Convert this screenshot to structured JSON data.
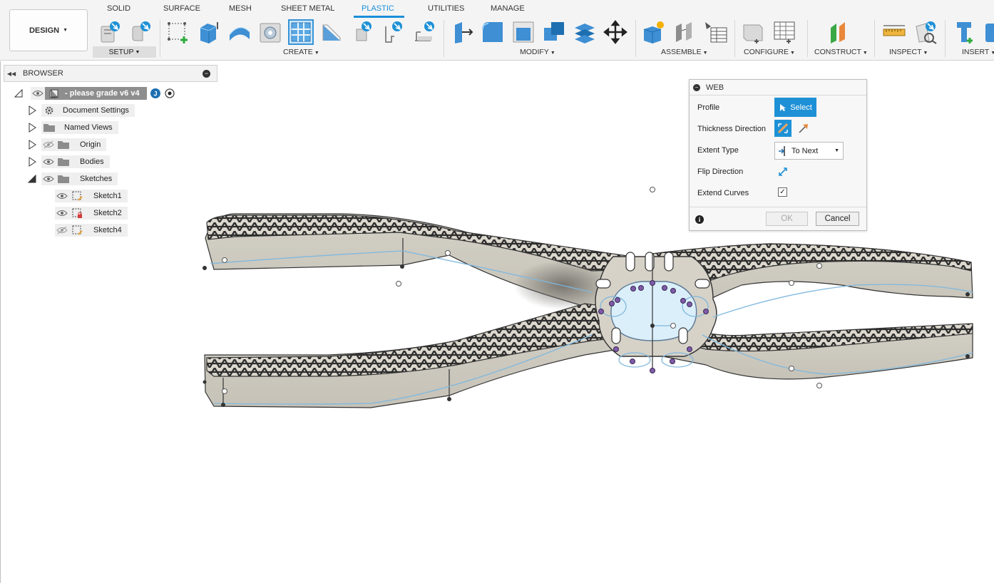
{
  "workspace": {
    "label": "DESIGN"
  },
  "tabs": [
    {
      "label": "SOLID",
      "active": false
    },
    {
      "label": "SURFACE",
      "active": false
    },
    {
      "label": "MESH",
      "active": false
    },
    {
      "label": "SHEET METAL",
      "active": false
    },
    {
      "label": "PLASTIC",
      "active": true
    },
    {
      "label": "UTILITIES",
      "active": false
    },
    {
      "label": "MANAGE",
      "active": false
    }
  ],
  "groups": {
    "setup": "SETUP",
    "create": "CREATE",
    "modify": "MODIFY",
    "assemble": "ASSEMBLE",
    "configure": "CONFIGURE",
    "construct": "CONSTRUCT",
    "inspect": "INSPECT",
    "insert": "INSERT"
  },
  "toolbar_icons": [
    "plastic-rule-icon",
    "material-icon",
    "create-sketch-icon",
    "extrude-box-icon",
    "shell-icon",
    "boss-icon",
    "web-icon",
    "rib-icon",
    "rest-icon",
    "lip-groove-icon",
    "snap-fit-icon",
    "press-pull-icon",
    "fillet-icon",
    "chamfer-icon",
    "combine-icon",
    "offset-face-icon",
    "move-icon",
    "new-component-icon",
    "joint-icon",
    "table-icon",
    "change-parameters-icon",
    "configure-table-icon",
    "offset-plane-icon",
    "measure-icon",
    "interference-icon",
    "insert-bolt-icon"
  ],
  "browser": {
    "title": "BROWSER",
    "root": "- please grade v6 v4",
    "items": [
      {
        "label": "Document Settings",
        "icon": "gear-icon"
      },
      {
        "label": "Named Views",
        "icon": "folder-icon"
      },
      {
        "label": "Origin",
        "icon": "folder-icon",
        "visible": false
      },
      {
        "label": "Bodies",
        "icon": "folder-icon",
        "visible": true
      },
      {
        "label": "Sketches",
        "icon": "folder-icon",
        "visible": true,
        "expanded": true
      }
    ],
    "sketches": [
      {
        "label": "Sketch1",
        "visible": true
      },
      {
        "label": "Sketch2",
        "visible": true,
        "locked": true
      },
      {
        "label": "Sketch4",
        "visible": false
      }
    ]
  },
  "dialog": {
    "title": "WEB",
    "profile_label": "Profile",
    "select_label": "Select",
    "thickness_label": "Thickness Direction",
    "extent_label": "Extent Type",
    "extent_value": "To Next",
    "flip_label": "Flip Direction",
    "extend_label": "Extend Curves",
    "extend_checked": true,
    "ok_label": "OK",
    "cancel_label": "Cancel"
  },
  "colors": {
    "accent": "#1a8fd9",
    "body": "#d8d4ca",
    "body_shadow": "#a39f95",
    "lattice": "#2e2e2e",
    "sketch_line": "#7fb8de"
  }
}
